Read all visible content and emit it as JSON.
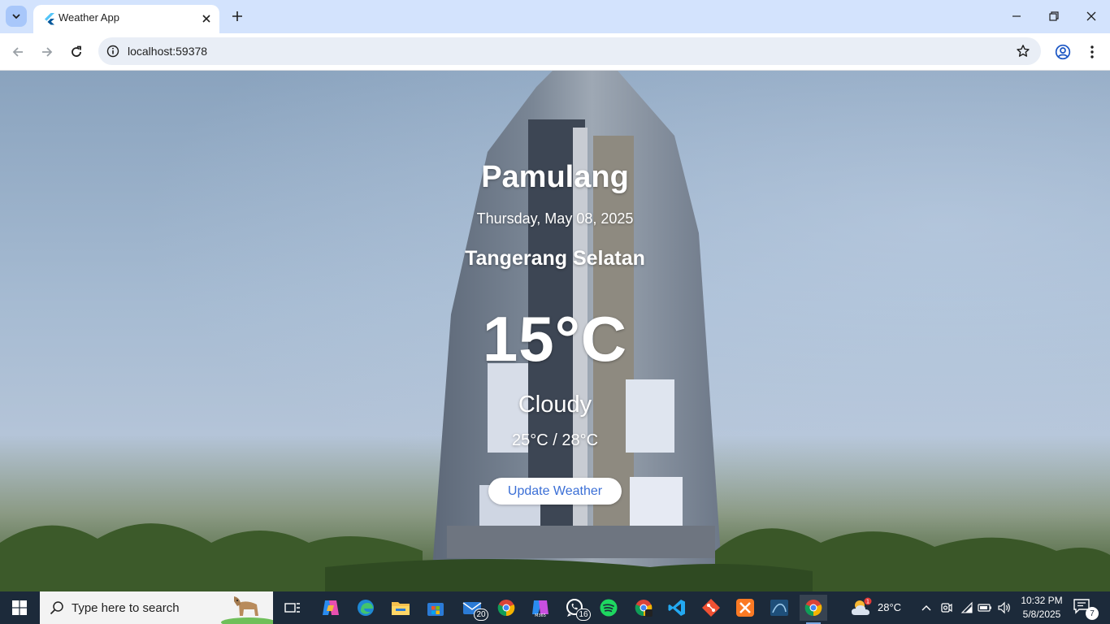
{
  "browser": {
    "tab_title": "Weather App",
    "url": "localhost:59378"
  },
  "weather": {
    "city": "Pamulang",
    "date": "Thursday, May 08, 2025",
    "region": "Tangerang Selatan",
    "temperature": "15°C",
    "condition": "Cloudy",
    "range": "25°C / 28°C",
    "update_button": "Update Weather"
  },
  "taskbar": {
    "search_placeholder": "Type here to search",
    "apps": [
      {
        "name": "task-view-icon"
      },
      {
        "name": "copilot-icon"
      },
      {
        "name": "edge-icon"
      },
      {
        "name": "file-explorer-icon"
      },
      {
        "name": "microsoft-store-icon"
      },
      {
        "name": "mail-icon",
        "badge": "20"
      },
      {
        "name": "chrome-icon"
      },
      {
        "name": "m365-icon"
      },
      {
        "name": "whatsapp-icon",
        "badge": "16"
      },
      {
        "name": "spotify-icon"
      },
      {
        "name": "chrome-profile-icon"
      },
      {
        "name": "vscode-icon"
      },
      {
        "name": "git-icon"
      },
      {
        "name": "xampp-icon"
      },
      {
        "name": "mysql-workbench-icon"
      },
      {
        "name": "chrome-active-icon"
      }
    ],
    "weather_temp": "28°C",
    "weather_badge": "1",
    "clock_time": "10:32 PM",
    "clock_date": "5/8/2025",
    "notification_count": "7"
  },
  "colors": {
    "tabstrip": "#d3e3fd",
    "button_text": "#3b6fd6",
    "taskbar": "#1c2a3a"
  }
}
